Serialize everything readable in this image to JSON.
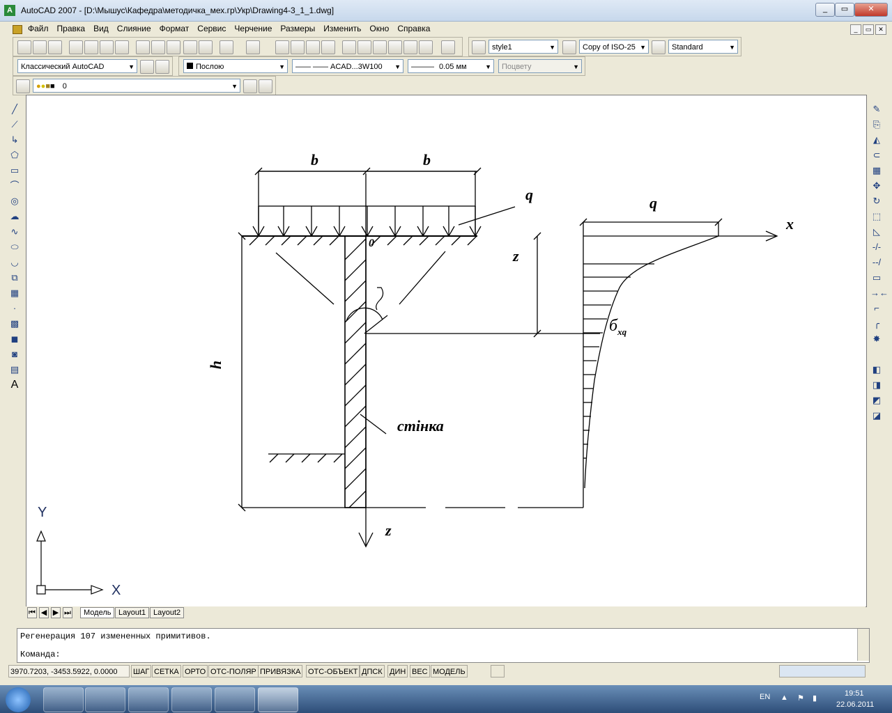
{
  "window": {
    "title": "AutoCAD 2007 - [D:\\Мышус\\Кафедра\\методичка_мех.гр\\Укр\\Drawing4-3_1_1.dwg]",
    "minimize": "_",
    "restore": "▭",
    "close": "✕"
  },
  "menu": [
    "Файл",
    "Правка",
    "Вид",
    "Слияние",
    "Формат",
    "Сервис",
    "Черчение",
    "Размеры",
    "Изменить",
    "Окно",
    "Справка"
  ],
  "toolbar": {
    "text_style": "style1",
    "dim_style": "Copy of ISO-25",
    "table_style": "Standard",
    "workspace": "Классический AutoCAD",
    "color": "Послою",
    "linetype": "ACAD...3W100",
    "lineweight": "0.05 мм",
    "plot_style": "Поцвету",
    "layer": "0"
  },
  "drawing": {
    "label_b_left": "b",
    "label_b_right": "b",
    "label_q_load": "q",
    "label_q_diagram": "q",
    "label_x": "x",
    "label_z_dim": "z",
    "label_z_axis": "z",
    "label_origin": "0",
    "label_h": "h",
    "label_theta": "θ",
    "label_wall": "стінка",
    "label_sigma": "б",
    "label_sigma_sub": "xq"
  },
  "ucs": {
    "y": "Y",
    "x": "X"
  },
  "layout_tabs": [
    "Модель",
    "Layout1",
    "Layout2"
  ],
  "command": {
    "history": "Регенерация 107 измененных примитивов.",
    "prompt": "Команда:"
  },
  "status": {
    "coords": "3970.7203, -3453.5922, 0.0000",
    "toggles": [
      "ШАГ",
      "СЕТКА",
      "ОРТО",
      "ОТС-ПОЛЯР",
      "ПРИВЯЗКА",
      "ОТС-ОБЪЕКТ",
      "ДПСК",
      "ДИН",
      "ВЕС",
      "МОДЕЛЬ"
    ]
  },
  "taskbar": {
    "lang": "EN",
    "time": "19:51",
    "date": "22.06.2011"
  }
}
